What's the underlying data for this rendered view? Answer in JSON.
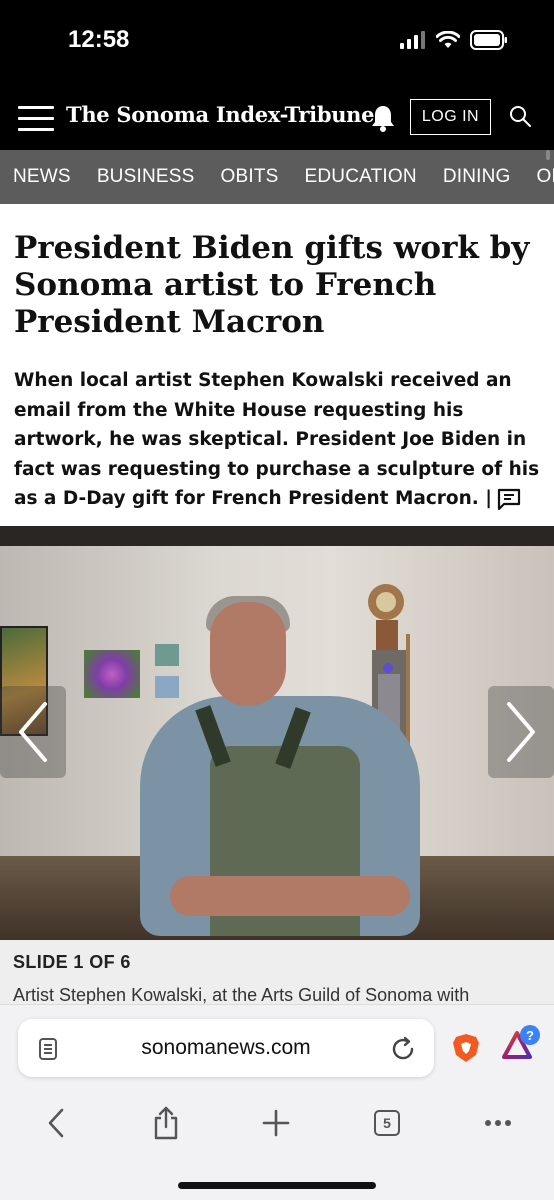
{
  "status_bar": {
    "time": "12:58"
  },
  "header": {
    "masthead": "The Sonoma Index-Tribune",
    "login_label": "LOG IN"
  },
  "nav": {
    "items": [
      "NEWS",
      "BUSINESS",
      "OBITS",
      "EDUCATION",
      "DINING",
      "OPI"
    ]
  },
  "article": {
    "headline": "President Biden gifts work by Sonoma artist to French President Macron",
    "dek": "When local artist Stephen Kowalski received an email from the White House requesting his artwork, he was skeptical. President Joe Biden in fact was requesting to purchase a sculpture of his as a D-Day gift for French President Macron.",
    "dek_separator": "|"
  },
  "gallery": {
    "slide_label": "SLIDE 1 OF 6",
    "caption": "Artist Stephen Kowalski, at the Arts Guild of Sonoma with"
  },
  "browser": {
    "url": "sonomanews.com",
    "rewards_badge": "?",
    "tab_count": "5"
  }
}
